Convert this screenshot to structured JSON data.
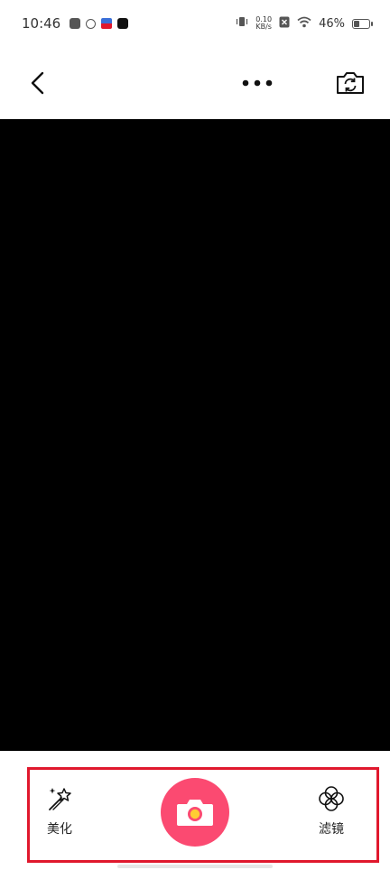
{
  "status_bar": {
    "time": "10:46",
    "net_speed_value": "0.10",
    "net_speed_unit": "KB/s",
    "battery_percent": "46%",
    "battery_level": 0.46
  },
  "nav": {
    "back_icon": "chevron-left-icon",
    "more_icon": "more-horizontal-icon",
    "switch_icon": "camera-switch-icon"
  },
  "toolbar": {
    "beauty_label": "美化",
    "filter_label": "滤镜"
  },
  "colors": {
    "accent": "#fb4a71",
    "frame": "#e0182d",
    "preview_bg": "#000000"
  }
}
